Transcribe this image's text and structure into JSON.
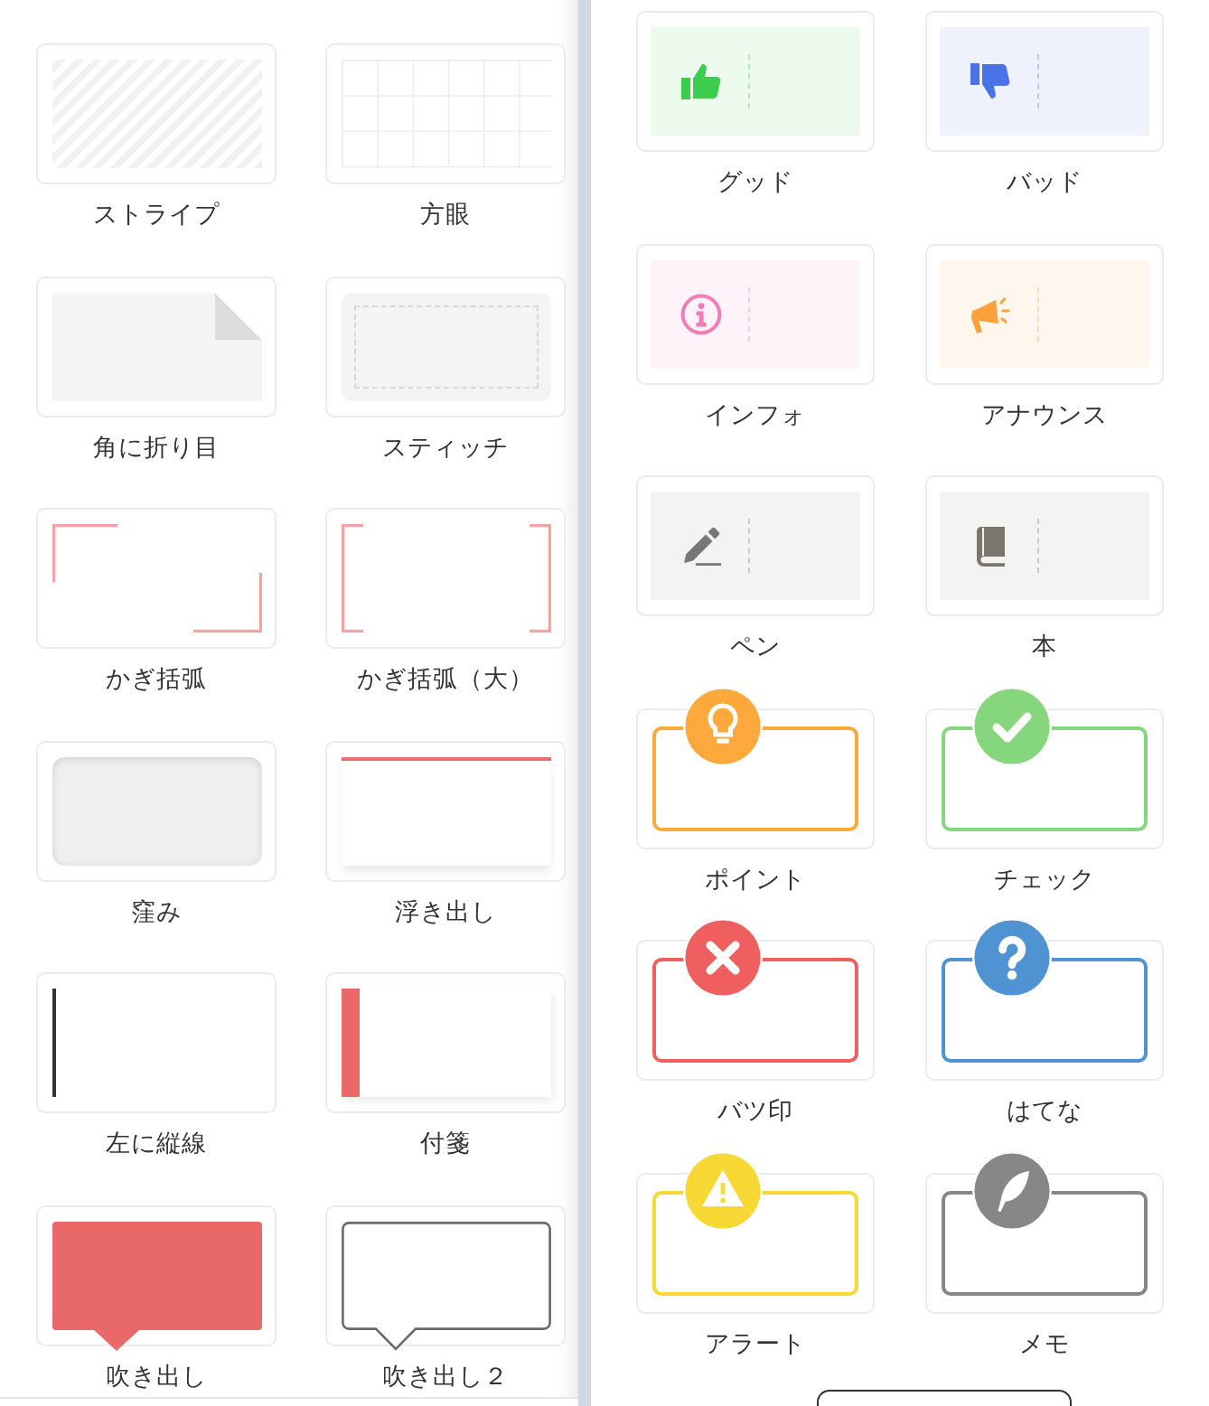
{
  "style_panel": {
    "items": [
      {
        "label": "ストライプ",
        "kind": "stripe"
      },
      {
        "label": "方眼",
        "kind": "grid"
      },
      {
        "label": "角に折り目",
        "kind": "fold"
      },
      {
        "label": "スティッチ",
        "kind": "stitch"
      },
      {
        "label": "かぎ括弧",
        "kind": "corners"
      },
      {
        "label": "かぎ括弧（大）",
        "kind": "brackets"
      },
      {
        "label": "窪み",
        "kind": "inset"
      },
      {
        "label": "浮き出し",
        "kind": "raised"
      },
      {
        "label": "左に縦線",
        "kind": "leftline"
      },
      {
        "label": "付箋",
        "kind": "tab"
      },
      {
        "label": "吹き出し",
        "kind": "bubble"
      },
      {
        "label": "吹き出し２",
        "kind": "outlinebubble"
      }
    ]
  },
  "icon_box_panel": {
    "items": [
      {
        "label": "グッド",
        "kind": "good",
        "color": "#3ccd4e"
      },
      {
        "label": "バッド",
        "kind": "bad",
        "color": "#4a73e8"
      },
      {
        "label": "インフォ",
        "kind": "info",
        "color": "#f17cb8"
      },
      {
        "label": "アナウンス",
        "kind": "announce",
        "color": "#ffa13a"
      },
      {
        "label": "ペン",
        "kind": "pen",
        "color": "#777777"
      },
      {
        "label": "本",
        "kind": "book",
        "color": "#7a766c"
      },
      {
        "label": "ポイント",
        "kind": "point",
        "color": "#ffa83b"
      },
      {
        "label": "チェック",
        "kind": "check",
        "color": "#86d67d"
      },
      {
        "label": "バツ印",
        "kind": "cross",
        "color": "#ef5f5f"
      },
      {
        "label": "はてな",
        "kind": "question",
        "color": "#4f93d2"
      },
      {
        "label": "アラート",
        "kind": "alert",
        "color": "#f7d835"
      },
      {
        "label": "メモ",
        "kind": "memo",
        "color": "#858789"
      }
    ]
  }
}
